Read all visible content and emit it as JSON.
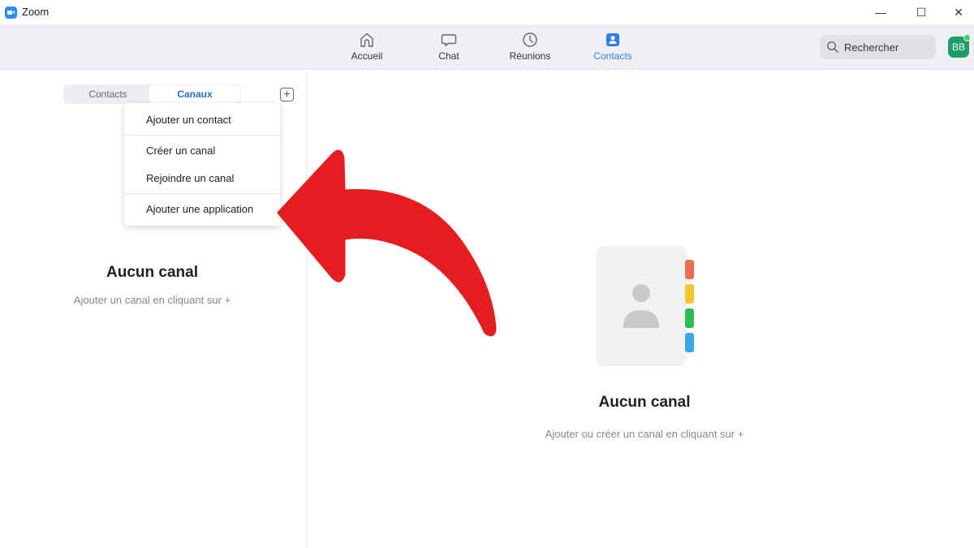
{
  "window": {
    "title": "Zoom",
    "controls": {
      "minimize": "—",
      "maximize": "☐",
      "close": "✕"
    }
  },
  "topnav": {
    "items": [
      {
        "label": "Accueil",
        "icon": "home-icon",
        "active": false
      },
      {
        "label": "Chat",
        "icon": "chat-bubble-icon",
        "active": false
      },
      {
        "label": "Réunions",
        "icon": "clock-icon",
        "active": false
      },
      {
        "label": "Contacts",
        "icon": "contact-card-icon",
        "active": true
      }
    ],
    "search": {
      "placeholder": "Rechercher",
      "icon": "search-icon"
    },
    "avatar": {
      "initials": "BB",
      "status": "online",
      "color": "#1c9e6c"
    }
  },
  "left_panel": {
    "tabs": [
      {
        "label": "Contacts",
        "active": false
      },
      {
        "label": "Canaux",
        "active": true
      }
    ],
    "add_button": {
      "label": "+",
      "icon": "plus-square-icon"
    },
    "dropdown_menu": {
      "groups": [
        [
          {
            "label": "Ajouter un contact"
          }
        ],
        [
          {
            "label": "Créer un canal"
          },
          {
            "label": "Rejoindre un canal"
          }
        ],
        [
          {
            "label": "Ajouter une application"
          }
        ]
      ]
    },
    "empty_state": {
      "title": "Aucun canal",
      "subtitle": "Ajouter un canal en cliquant sur +"
    }
  },
  "main_panel": {
    "illustration": "address-book-icon",
    "empty_state": {
      "title": "Aucun canal",
      "subtitle": "Ajouter ou créer un canal en cliquant sur +"
    }
  },
  "annotation": {
    "type": "curved-arrow",
    "points_to": "dropdown_menu",
    "color": "#e41e20"
  },
  "colors": {
    "accent": "#2d7ff0",
    "nav_background": "#f0f0f4",
    "tab_marker_red": "#f26b4f",
    "tab_marker_yellow": "#f7c62a",
    "tab_marker_green": "#2ebd55",
    "tab_marker_blue": "#3ba6ea"
  }
}
